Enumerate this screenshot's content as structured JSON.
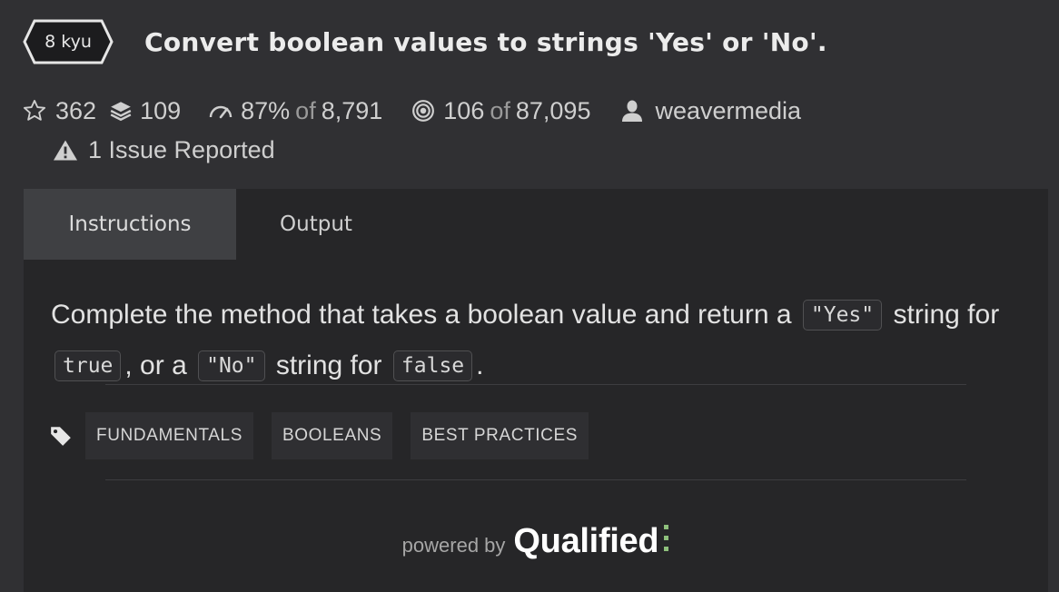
{
  "kata": {
    "rank": "8 kyu",
    "title": "Convert boolean values to strings 'Yes' or 'No'."
  },
  "stats": {
    "stars": "362",
    "collections": "109",
    "satisfaction_pct": "87%",
    "satisfaction_of": "of",
    "satisfaction_total": "8,791",
    "completed": "106",
    "completed_of": "of",
    "completed_total": "87,095",
    "author": "weavermedia",
    "issues": "1 Issue Reported"
  },
  "tabs": [
    {
      "label": "Instructions",
      "active": true
    },
    {
      "label": "Output",
      "active": false
    }
  ],
  "description": {
    "p1": "Complete the method that takes a boolean value and return a",
    "code1": "\"Yes\"",
    "p2": "string for",
    "code2": "true",
    "p3": ", or a",
    "code3": "\"No\"",
    "p4": "string for",
    "code4": "false",
    "p5": "."
  },
  "tags": [
    "FUNDAMENTALS",
    "BOOLEANS",
    "BEST PRACTICES"
  ],
  "footer": {
    "powered_by": "powered by",
    "brand": "Qualified"
  },
  "icons": {
    "star": "star-icon",
    "collections": "layers-icon",
    "satisfaction": "gauge-icon",
    "completed": "target-icon",
    "author": "user-icon",
    "issue": "warning-icon",
    "tag": "tag-icon"
  },
  "colors": {
    "background": "#303033",
    "panel": "#262628",
    "active_tab": "#3f4043",
    "brand_dot": "#8ec07c"
  }
}
